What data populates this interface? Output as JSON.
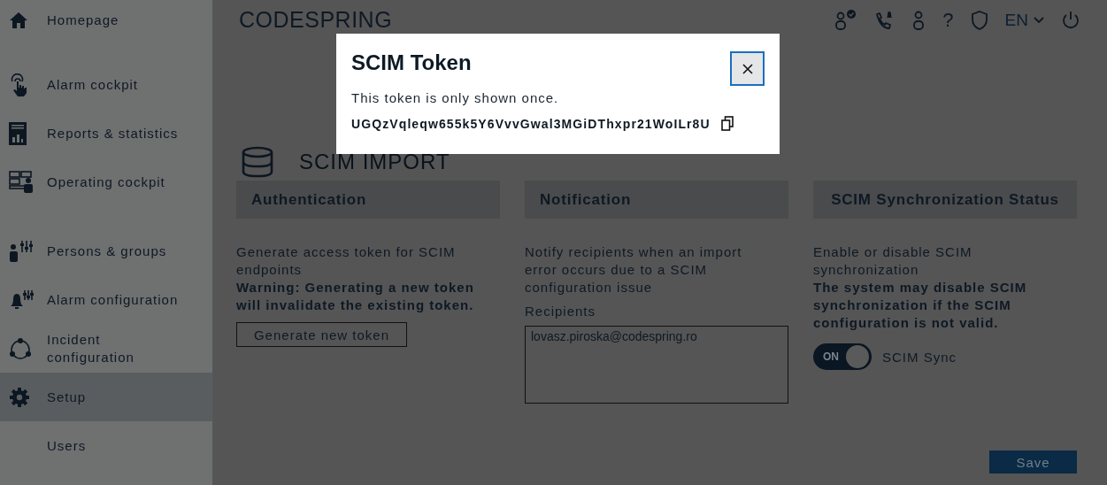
{
  "header": {
    "logo": "CODESPRING",
    "help": "?",
    "language": "EN"
  },
  "sidebar": {
    "groups": [
      [
        {
          "label": "Homepage",
          "kind": "main",
          "selected": false
        }
      ],
      [
        {
          "label": "Alarm cockpit",
          "kind": "main",
          "selected": false
        },
        {
          "label": "Reports & statistics",
          "kind": "main",
          "selected": false
        },
        {
          "label": "Operating cockpit",
          "kind": "main",
          "selected": false
        }
      ],
      [
        {
          "label": "Persons & groups",
          "kind": "main",
          "selected": false
        },
        {
          "label": "Alarm configuration",
          "kind": "main",
          "selected": false
        },
        {
          "label": "Incident configuration",
          "kind": "main",
          "selected": false
        },
        {
          "label": "Setup",
          "kind": "main",
          "selected": true
        },
        {
          "label": "Users",
          "kind": "sub",
          "selected": false
        }
      ]
    ]
  },
  "page": {
    "title": "SCIM IMPORT"
  },
  "sections": [
    {
      "kind": "auth",
      "title": "Authentication",
      "description": "Generate access token for SCIM endpoints",
      "warning": "Warning: Generating a new token will invalidate the existing token.",
      "button": "Generate new token"
    },
    {
      "kind": "notification",
      "title": "Notification",
      "description": "Notify recipients when an import error occurs due to a SCIM configuration issue",
      "recipients_label": "Recipients",
      "recipients": "lovasz.piroska@codespring.ro"
    },
    {
      "kind": "sync",
      "title": "SCIM Synchronization Status",
      "description": "Enable or disable SCIM synchronization",
      "warning": "The system may disable SCIM synchronization if the SCIM configuration is not valid.",
      "toggle": {
        "on": true,
        "state_label": "ON",
        "label": "SCIM Sync"
      }
    }
  ],
  "save_button": "Save",
  "modal": {
    "title": "SCIM Token",
    "message": "This token is only shown once.",
    "token": "UGQzVqleqw655k5Y6VvvGwal3MGiDThxpr21WoILr8U"
  }
}
